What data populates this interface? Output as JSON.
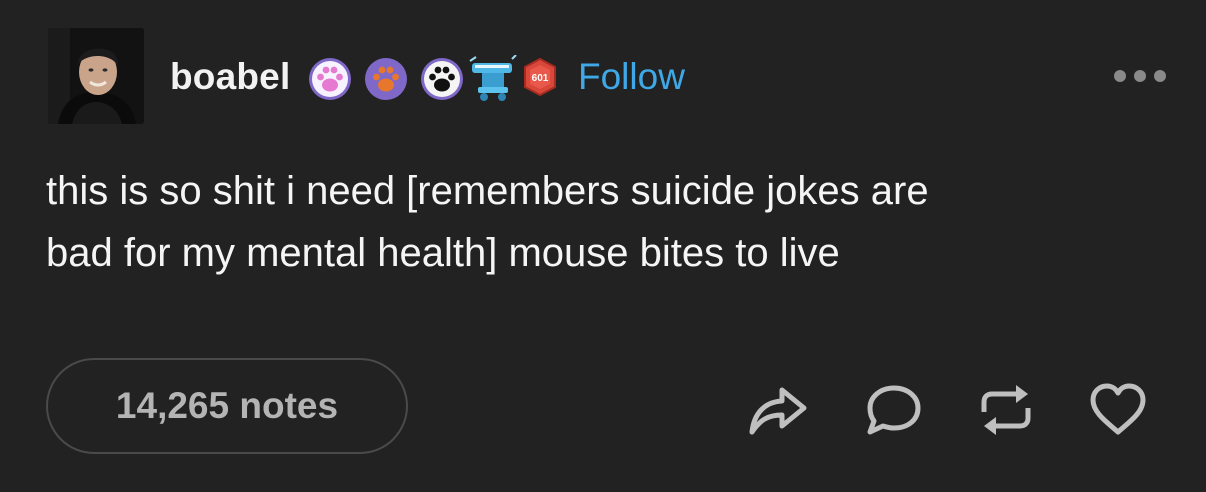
{
  "post": {
    "username": "boabel",
    "badges": [
      {
        "icon": "paw-badge-pink-icon"
      },
      {
        "icon": "paw-badge-orange-icon"
      },
      {
        "icon": "paw-badge-black-icon"
      },
      {
        "icon": "ice-cream-badge-icon"
      },
      {
        "icon": "level-badge-icon",
        "label": "601"
      }
    ],
    "follow_label": "Follow",
    "body_lines": [
      "this is so shit i need [remembers suicide jokes are",
      "bad for my mental health] mouse bites to live"
    ],
    "notes_label": "14,265 notes",
    "actions": [
      "share-icon",
      "reply-icon",
      "reblog-icon",
      "like-icon"
    ]
  },
  "colors": {
    "background": "#222222",
    "follow": "#3fa9e8",
    "notes_text": "#b4b4b4",
    "icons": "#bfbfbf"
  }
}
